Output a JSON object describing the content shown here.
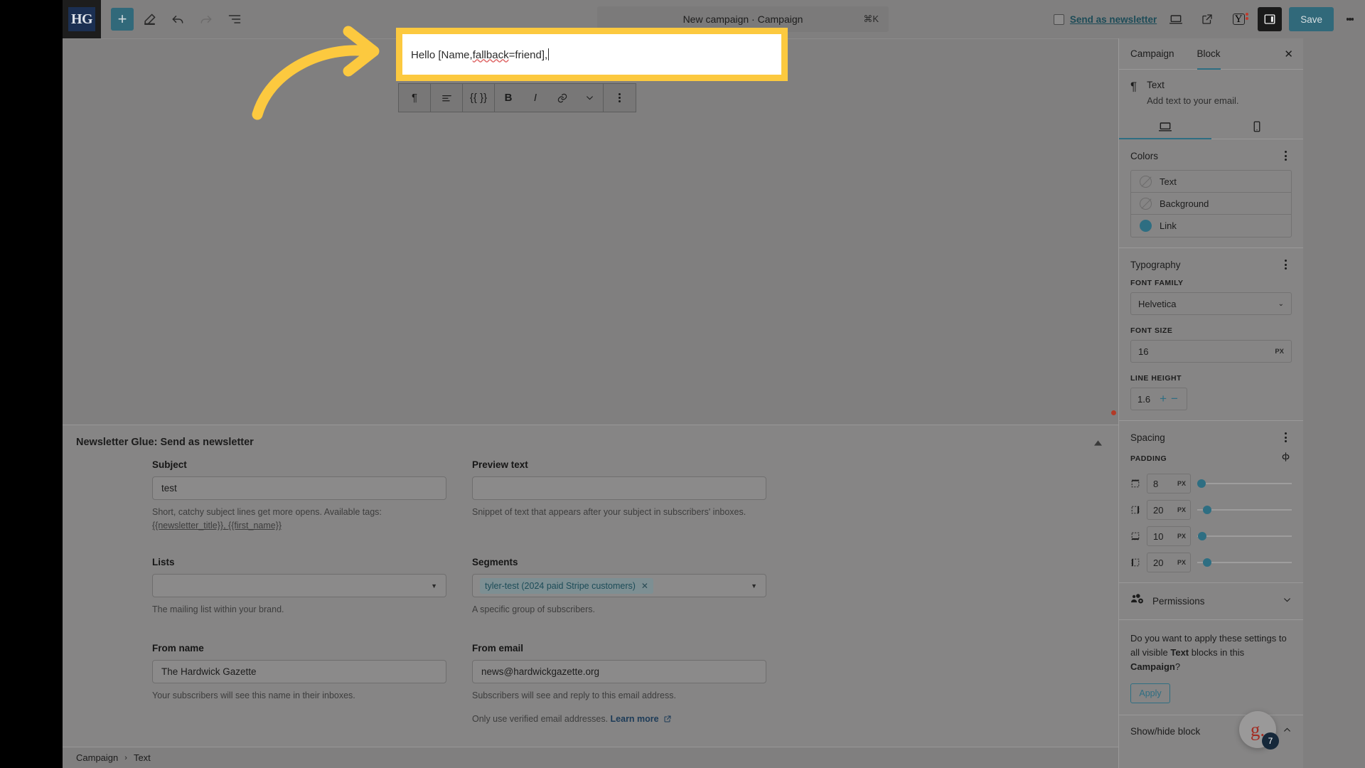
{
  "topbar": {
    "logo_text": "HG",
    "add_icon": "plus-icon",
    "edit_icon": "pencil-icon",
    "undo_icon": "undo-icon",
    "redo_icon": "redo-icon",
    "listview_icon": "list-view-icon",
    "title": "New campaign · Campaign",
    "shortcut": "⌘K",
    "send_as_newsletter_label": "Send as newsletter",
    "preview_icon": "desktop-preview-icon",
    "view_icon": "external-link-icon",
    "yoast_icon": "yoast-icon",
    "yoast_glyph": "Y",
    "sidebar_toggle_icon": "settings-sidebar-icon",
    "save_label": "Save",
    "options_icon": "vertical-kebab-icon"
  },
  "editor": {
    "block_text_prefix": "Hello [Name,",
    "block_text_misspelled": "fallback",
    "block_text_suffix": "=friend],",
    "highlight_color": "#fcc93f",
    "toolbar": {
      "paragraph_icon": "¶",
      "align_icon": "align-left-icon",
      "merge_tag_label": "{{ }}",
      "bold_label": "B",
      "italic_label": "I",
      "link_icon": "link-icon",
      "more_formats_icon": "chevron-down-icon",
      "options_icon": "vertical-kebab-icon"
    }
  },
  "newsletter_panel": {
    "title": "Newsletter Glue: Send as newsletter",
    "collapse_icon": "collapse-caret-icon",
    "fields": {
      "subject": {
        "label": "Subject",
        "value": "test",
        "help_line1": "Short, catchy subject lines get more opens. Available tags:",
        "help_tags": "{{newsletter_title}}, {{first_name}}"
      },
      "preview_text": {
        "label": "Preview text",
        "value": "",
        "help": "Snippet of text that appears after your subject in subscribers' inboxes."
      },
      "lists": {
        "label": "Lists",
        "value": "",
        "help": "The mailing list within your brand."
      },
      "segments": {
        "label": "Segments",
        "chip": "tyler-test (2024 paid Stripe customers)",
        "chip_remove": "✕",
        "help": "A specific group of subscribers."
      },
      "from_name": {
        "label": "From name",
        "value": "The Hardwick Gazette",
        "help": "Your subscribers will see this name in their inboxes."
      },
      "from_email": {
        "label": "From email",
        "value": "news@hardwickgazette.org",
        "help": "Subscribers will see and reply to this email address.",
        "help2_prefix": "Only use verified email addresses. ",
        "help2_link": "Learn more"
      }
    }
  },
  "breadcrumb": {
    "root": "Campaign",
    "separator": "›",
    "current": "Text"
  },
  "sidebar": {
    "tabs": [
      {
        "label": "Campaign",
        "active": false
      },
      {
        "label": "Block",
        "active": true
      }
    ],
    "close_icon": "close-icon",
    "block": {
      "icon": "¶",
      "title": "Text",
      "description": "Add text to your email."
    },
    "device_tabs": [
      {
        "icon": "desktop-icon",
        "active": true
      },
      {
        "icon": "mobile-icon",
        "active": false
      }
    ],
    "colors": {
      "title": "Colors",
      "options_icon": "vertical-kebab-icon",
      "rows": [
        {
          "label": "Text",
          "value": ""
        },
        {
          "label": "Background",
          "value": ""
        },
        {
          "label": "Link",
          "value": "#2e6e82"
        }
      ]
    },
    "typography": {
      "title": "Typography",
      "options_icon": "vertical-kebab-icon",
      "font_family_label": "FONT FAMILY",
      "font_family_value": "Helvetica",
      "font_size_label": "FONT SIZE",
      "font_size_value": "16",
      "font_size_unit": "PX",
      "line_height_label": "LINE HEIGHT",
      "line_height_value": "1.6",
      "increment_label": "+",
      "decrement_label": "−"
    },
    "spacing": {
      "title": "Spacing",
      "options_icon": "vertical-kebab-icon",
      "padding_label": "PADDING",
      "unlink_icon": "unlink-sides-icon",
      "padding": [
        {
          "side": "top",
          "value": "8",
          "unit": "PX",
          "fill": 0.04
        },
        {
          "side": "right",
          "value": "20",
          "unit": "PX",
          "fill": 0.1
        },
        {
          "side": "bottom",
          "value": "10",
          "unit": "PX",
          "fill": 0.05
        },
        {
          "side": "left",
          "value": "20",
          "unit": "PX",
          "fill": 0.1
        }
      ]
    },
    "permissions": {
      "title": "Permissions",
      "icon": "permissions-icon",
      "chevron": "chevron-down-icon"
    },
    "apply_all": {
      "question_part1": "Do you want to apply these settings to all visible ",
      "question_bold1": "Text",
      "question_part2": " blocks in this ",
      "question_bold2": "Campaign",
      "question_part3": "?",
      "button_label": "Apply"
    },
    "show_hide_block": {
      "label": "Show/hide block",
      "chevron": "chevron-up-icon"
    }
  },
  "widget": {
    "glyph": "g.",
    "badge_count": "7"
  },
  "annotation": {
    "arrow_color": "#fcc93f",
    "arrow_icon": "curved-arrow-right-icon"
  }
}
